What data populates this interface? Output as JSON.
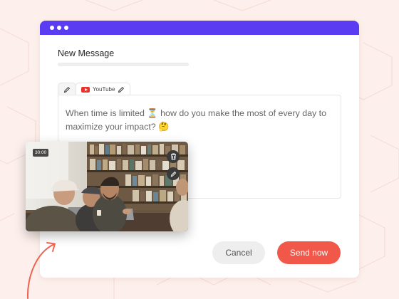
{
  "window": {
    "title": "New Message"
  },
  "tabs": [
    {
      "label": "",
      "icon": "pencil-icon"
    },
    {
      "label": "YouTube",
      "icon": "youtube-icon"
    }
  ],
  "editor": {
    "message": "When time is limited ⏳ how do you make the most of every day to maximize your impact? 🤔"
  },
  "video": {
    "duration": "30:00"
  },
  "actions": {
    "cancel_label": "Cancel",
    "send_label": "Send now"
  },
  "colors": {
    "titlebar": "#5a3cf2",
    "send": "#f2584a",
    "background": "#fdf0ec"
  }
}
